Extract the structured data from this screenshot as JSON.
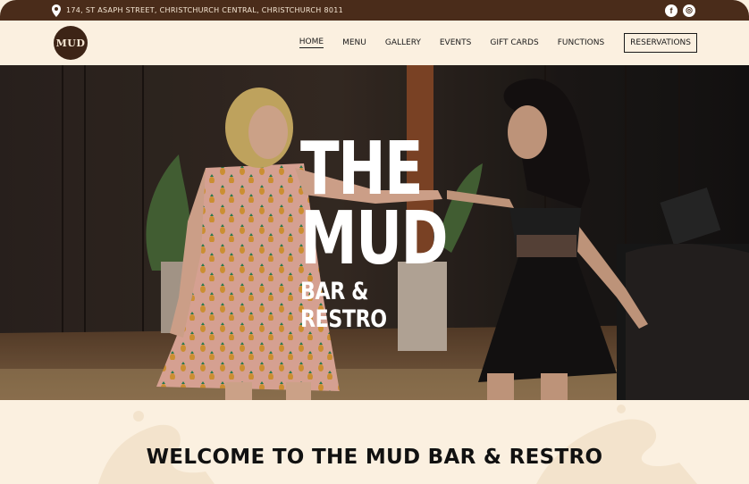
{
  "topbar": {
    "address": "174, ST ASAPH STREET, CHRISTCHURCH CENTRAL, CHRISTCHURCH 8011",
    "socials": [
      {
        "icon": "facebook-icon",
        "glyph": "f"
      },
      {
        "icon": "instagram-icon",
        "glyph": "◎"
      }
    ]
  },
  "header": {
    "logo_text": "MUD",
    "nav": [
      {
        "label": "HOME",
        "active": true
      },
      {
        "label": "MENU"
      },
      {
        "label": "GALLERY"
      },
      {
        "label": "EVENTS"
      },
      {
        "label": "GIFT CARDS"
      },
      {
        "label": "FUNCTIONS"
      }
    ],
    "cta": "RESERVATIONS"
  },
  "hero": {
    "title_line1": "THE",
    "title_line2": "MUD",
    "title_line3": "BAR & RESTRO"
  },
  "welcome": {
    "heading": "WELCOME TO THE MUD BAR & RESTRO"
  },
  "colors": {
    "brand_dark": "#4a2c1a",
    "cream": "#fbf0e0",
    "text": "#111111"
  }
}
